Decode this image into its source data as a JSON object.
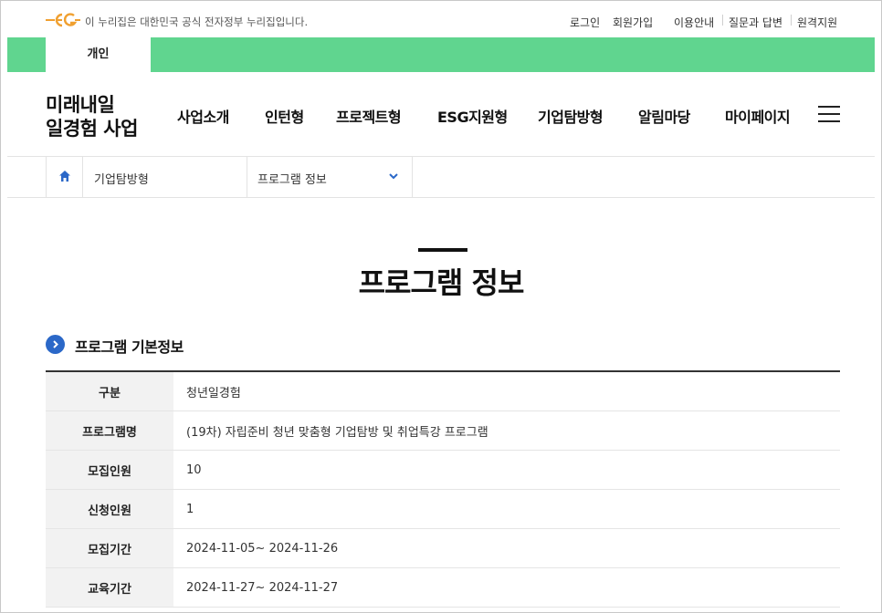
{
  "topbar": {
    "logo_icon": "eg-government-logo",
    "gov_notice": "이 누리집은 대한민국 공식 전자정부 누리집입니다.",
    "links": [
      "로그인",
      "회원가입",
      "이용안내",
      "질문과 답변",
      "원격지원"
    ]
  },
  "tabs": {
    "personal": "개인"
  },
  "site": {
    "logo_line1": "미래내일",
    "logo_line2": "일경험 사업"
  },
  "gnb": [
    "사업소개",
    "인턴형",
    "프로젝트형",
    "ESG지원형",
    "기업탐방형",
    "알림마당",
    "마이페이지"
  ],
  "breadcrumb": {
    "level1": "기업탐방형",
    "level2": "프로그램 정보"
  },
  "page": {
    "title": "프로그램 정보"
  },
  "section": {
    "title": "프로그램 기본정보"
  },
  "table": {
    "rows": [
      {
        "label": "구분",
        "value": "청년일경험"
      },
      {
        "label": "프로그램명",
        "value": "(19차) 자립준비 청년 맞춤형 기업탐방 및 취업특강 프로그램"
      },
      {
        "label": "모집인원",
        "value": "10"
      },
      {
        "label": "신청인원",
        "value": "1"
      },
      {
        "label": "모집기간",
        "value": "2024-11-05~ 2024-11-26"
      },
      {
        "label": "교육기간",
        "value": "2024-11-27~ 2024-11-27"
      }
    ]
  },
  "colors": {
    "green_bar": "#60d58f",
    "logo_orange": "#f0a030",
    "accent_blue": "#2b68c8"
  }
}
